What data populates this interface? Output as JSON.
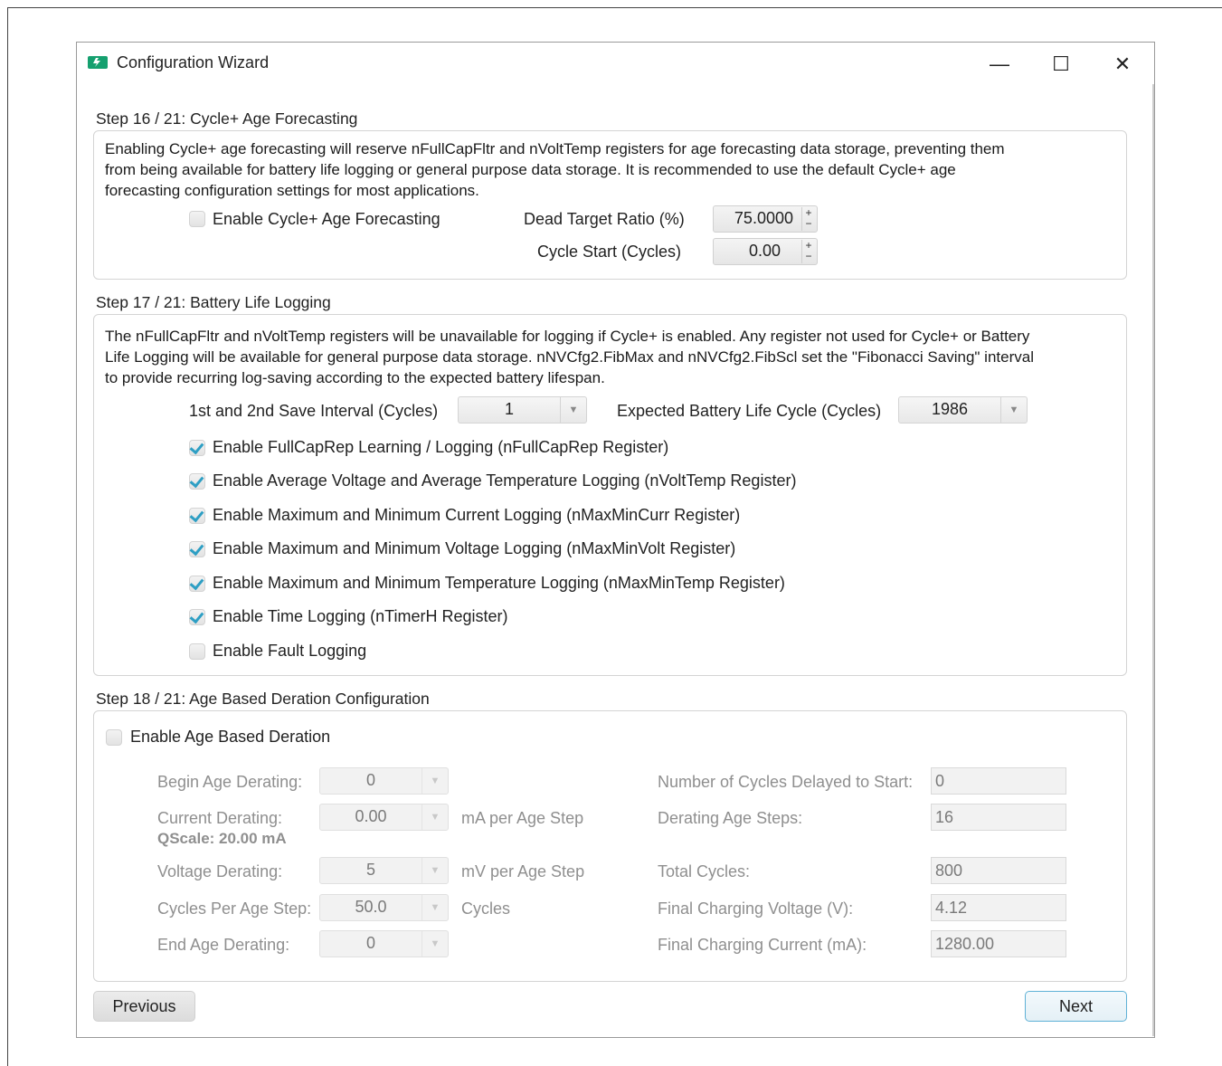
{
  "window": {
    "title": "Configuration Wizard",
    "min_glyph": "—",
    "max_glyph": "☐",
    "close_glyph": "✕"
  },
  "step16": {
    "title": "Step 16 / 21: Cycle+ Age Forecasting",
    "desc_lines": [
      "Enabling Cycle+ age forecasting will reserve nFullCapFltr and nVoltTemp registers for age forecasting data storage, preventing them",
      "from being available for battery life logging or general purpose data storage. It is recommended to use the default Cycle+ age",
      "forecasting configuration settings for most applications."
    ],
    "enable_label": "Enable Cycle+ Age Forecasting",
    "enable_checked": false,
    "dead_target_label": "Dead Target Ratio (%)",
    "dead_target_value": "75.0000",
    "cycle_start_label": "Cycle Start (Cycles)",
    "cycle_start_value": "0.00"
  },
  "step17": {
    "title": "Step 17 / 21: Battery Life Logging",
    "desc_lines": [
      "The nFullCapFltr and nVoltTemp registers will be unavailable for logging if Cycle+ is enabled. Any register not used for Cycle+ or Battery",
      "Life Logging will be available for general purpose data storage. nNVCfg2.FibMax and nNVCfg2.FibScl set the \"Fibonacci Saving\" interval",
      "to provide recurring log-saving according to the expected battery lifespan."
    ],
    "save_interval_label": "1st and 2nd Save Interval (Cycles)",
    "save_interval_value": "1",
    "battery_life_label": "Expected Battery Life Cycle (Cycles)",
    "battery_life_value": "1986",
    "checkboxes": [
      {
        "label": "Enable FullCapRep Learning / Logging (nFullCapRep Register)",
        "checked": true
      },
      {
        "label": "Enable Average Voltage and Average Temperature Logging (nVoltTemp Register)",
        "checked": true
      },
      {
        "label": "Enable Maximum and Minimum Current Logging (nMaxMinCurr Register)",
        "checked": true
      },
      {
        "label": "Enable Maximum and Minimum Voltage Logging (nMaxMinVolt Register)",
        "checked": true
      },
      {
        "label": "Enable Maximum and Minimum Temperature Logging (nMaxMinTemp Register)",
        "checked": true
      },
      {
        "label": "Enable Time Logging (nTimerH Register)",
        "checked": true
      },
      {
        "label": "Enable Fault Logging",
        "checked": false
      }
    ]
  },
  "step18": {
    "title": "Step 18 / 21: Age Based Deration Configuration",
    "enable_label": "Enable Age Based Deration",
    "enable_checked": false,
    "begin_label": "Begin Age Derating:",
    "begin_value": "0",
    "current_label": "Current Derating:",
    "current_value": "0.00",
    "current_unit": "mA per Age Step",
    "qscale_label": "QScale: 20.00 mA",
    "voltage_label": "Voltage Derating:",
    "voltage_value": "5",
    "voltage_unit": "mV per Age Step",
    "cycles_label": "Cycles Per Age Step:",
    "cycles_value": "50.0",
    "cycles_unit": "Cycles",
    "end_label": "End Age Derating:",
    "end_value": "0",
    "delayed_label": "Number of Cycles Delayed to Start:",
    "delayed_value": "0",
    "steps_label": "Derating Age Steps:",
    "steps_value": "16",
    "total_label": "Total Cycles:",
    "total_value": "800",
    "final_v_label": "Final Charging Voltage (V):",
    "final_v_value": "4.12",
    "final_i_label": "Final Charging Current (mA):",
    "final_i_value": "1280.00"
  },
  "buttons": {
    "previous": "Previous",
    "next": "Next"
  }
}
